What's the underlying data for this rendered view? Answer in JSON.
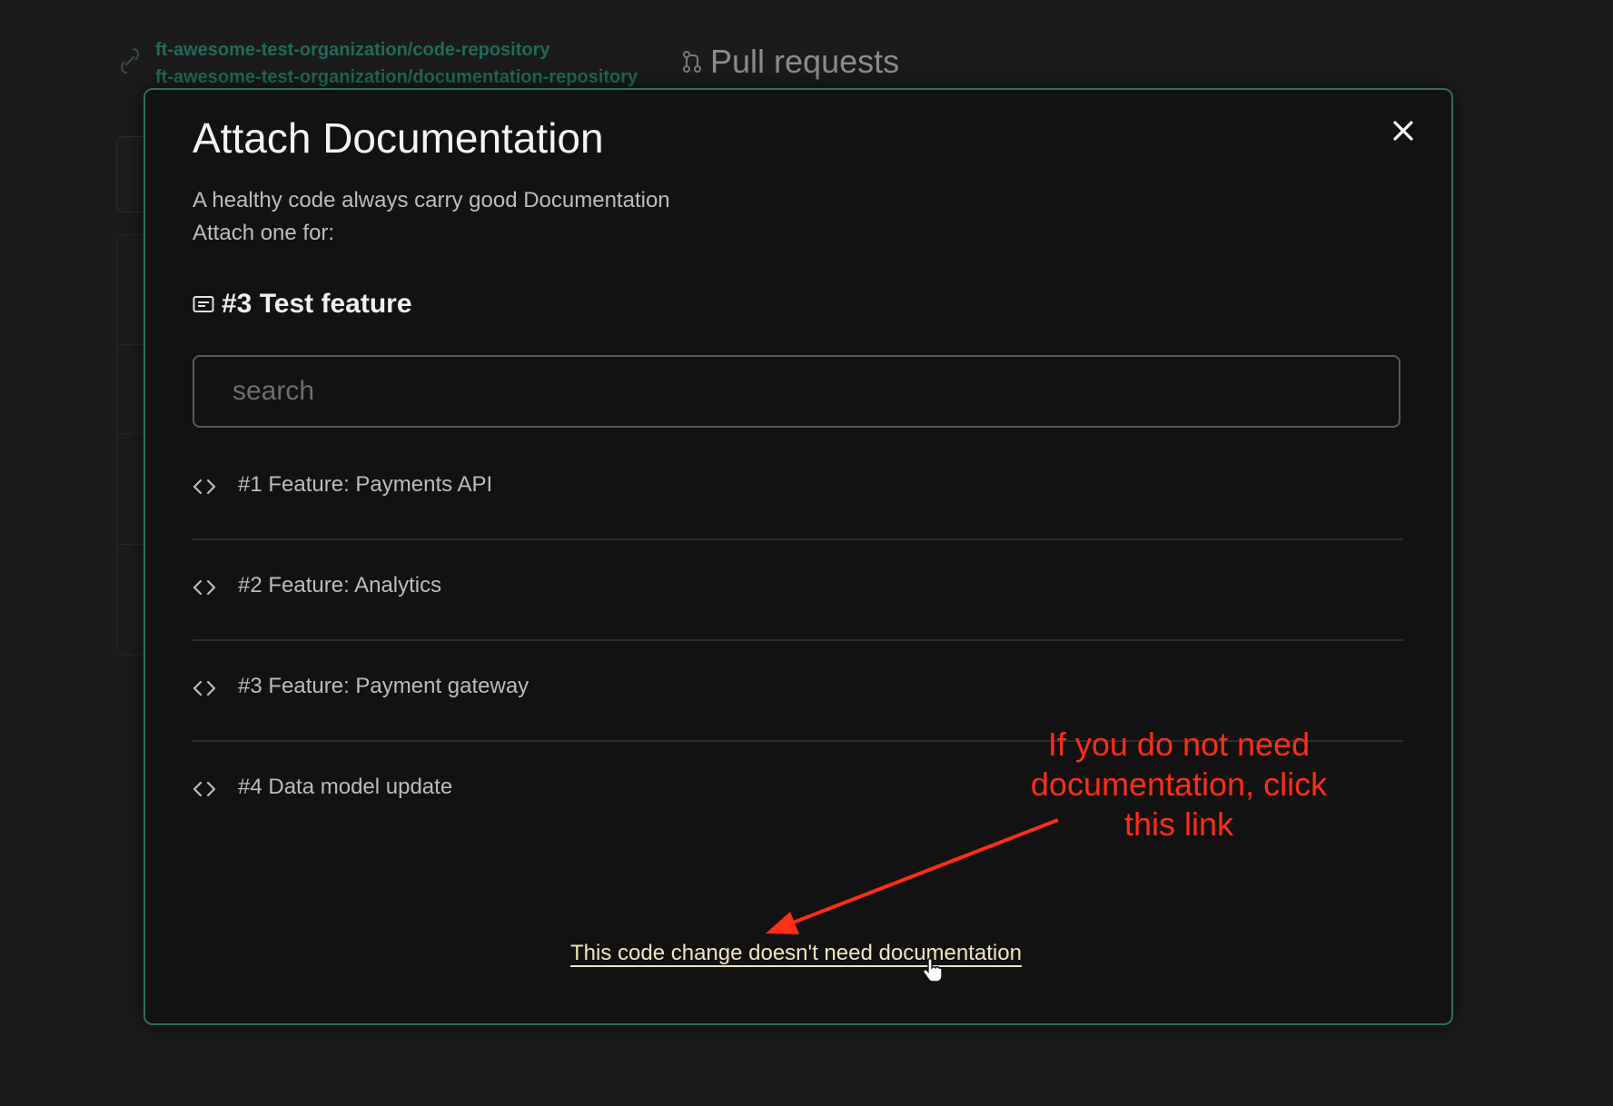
{
  "background": {
    "repos": [
      "ft-awesome-test-organization/code-repository",
      "ft-awesome-test-organization/documentation-repository"
    ],
    "section_title": "Pull requests"
  },
  "modal": {
    "title": "Attach Documentation",
    "subtitle_lines": [
      "A healthy code always carry good Documentation",
      "Attach one for:"
    ],
    "target": {
      "label": "#3 Test feature",
      "icon": "ticket-icon"
    },
    "search": {
      "placeholder": "search",
      "value": ""
    },
    "items": [
      {
        "label": "#1 Feature: Payments API",
        "icon": "code-icon"
      },
      {
        "label": "#2 Feature: Analytics",
        "icon": "code-icon"
      },
      {
        "label": "#3 Feature: Payment gateway",
        "icon": "code-icon"
      },
      {
        "label": "#4 Data model update",
        "icon": "code-icon"
      }
    ],
    "no_doc_link": "This code change doesn't need documentation",
    "close_icon": "close-icon"
  },
  "annotation": {
    "lines": [
      "If you do not need",
      "documentation, click",
      "this link"
    ],
    "color": "#ff2e17"
  },
  "colors": {
    "accent_border": "#2b6e60",
    "repo_link": "#1f6b5a",
    "link_text": "#f1e6bf"
  }
}
